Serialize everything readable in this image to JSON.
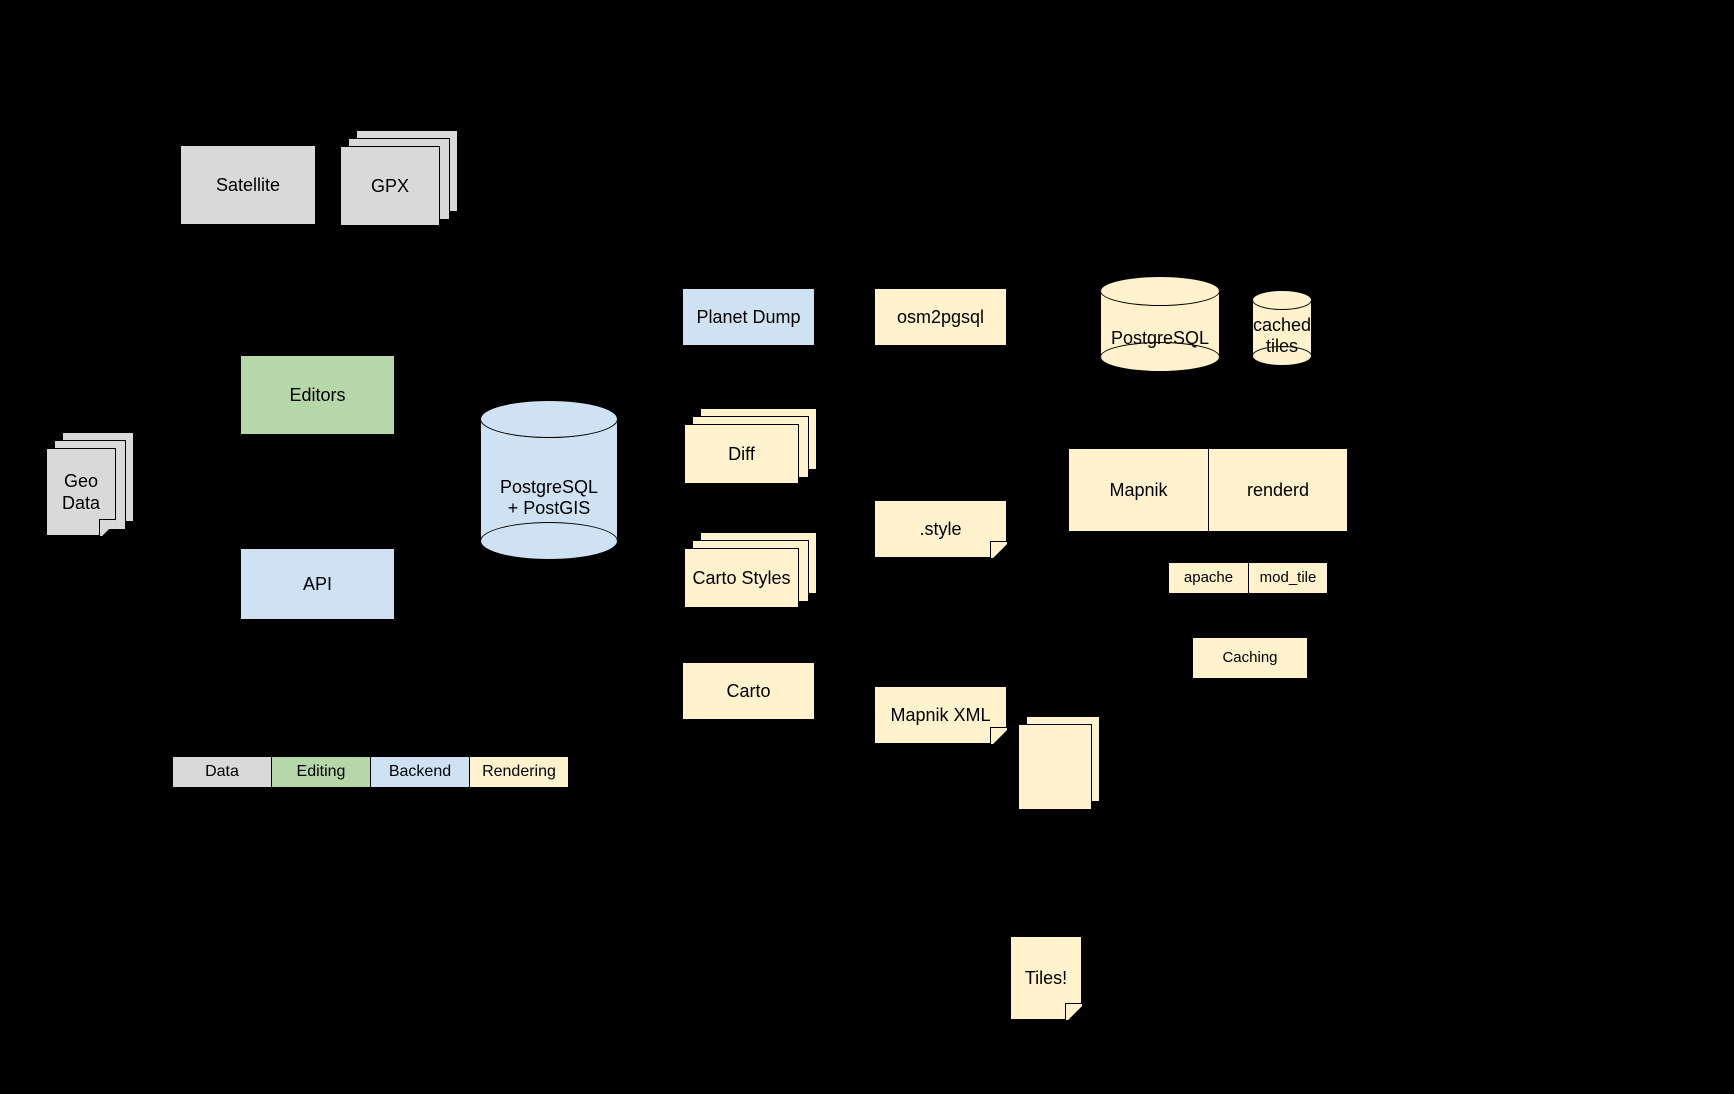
{
  "nodes": {
    "satellite": "Satellite",
    "gpx": "GPX",
    "geo_data_l1": "Geo",
    "geo_data_l2": "Data",
    "editors": "Editors",
    "api": "API",
    "db_pg_postgis_l1": "PostgreSQL",
    "db_pg_postgis_l2": "+ PostGIS",
    "planet_dump": "Planet Dump",
    "diff": "Diff",
    "carto_styles": "Carto Styles",
    "carto": "Carto",
    "osm2pgsql": "osm2pgsql",
    "style_file": ".style",
    "mapnik_xml": "Mapnik XML",
    "db_pg": "PostgreSQL",
    "cached_tiles_l1": "cached",
    "cached_tiles_l2": "tiles",
    "mapnik": "Mapnik",
    "renderd": "renderd",
    "apache": "apache",
    "mod_tile": "mod_tile",
    "caching": "Caching",
    "tiles": "Tiles!"
  },
  "legend": {
    "data": "Data",
    "editing": "Editing",
    "backend": "Backend",
    "rendering": "Rendering"
  },
  "colors": {
    "data": "#d9d9d9",
    "editing": "#b6d7a8",
    "backend": "#cfe2f3",
    "rendering": "#fff2cc",
    "bg": "#000000"
  },
  "arrows": [
    {
      "from": "satellite",
      "to": "editors"
    },
    {
      "from": "gpx",
      "to": "editors"
    },
    {
      "from": "geo_data",
      "to": "editors"
    },
    {
      "from": "geo_data",
      "to": "api"
    },
    {
      "from": "editors",
      "to": "api",
      "bidir": true
    },
    {
      "from": "api",
      "to": "postgresql_postgis",
      "bidir": true
    },
    {
      "from": "postgresql_postgis",
      "to": "planet_dump"
    },
    {
      "from": "postgresql_postgis",
      "to": "diff"
    },
    {
      "from": "planet_dump",
      "to": "osm2pgsql"
    },
    {
      "from": "diff",
      "to": "osm2pgsql"
    },
    {
      "from": "style_file",
      "to": "osm2pgsql"
    },
    {
      "from": "carto_styles",
      "to": "carto"
    },
    {
      "from": "carto",
      "to": "mapnik_xml"
    },
    {
      "from": "osm2pgsql",
      "to": "postgresql_render"
    },
    {
      "from": "postgresql_render",
      "to": "mapnik"
    },
    {
      "from": "mapnik_xml",
      "to": "mapnik"
    },
    {
      "from": "mapnik",
      "to": "renderd",
      "bidir": true
    },
    {
      "from": "renderd",
      "to": "cached_tiles",
      "bidir": true
    },
    {
      "from": "renderd",
      "to": "mod_tile",
      "bidir": true
    },
    {
      "from": "apache",
      "to": "mod_tile",
      "adjacent": true
    },
    {
      "from": "mod_tile",
      "to": "caching"
    },
    {
      "from": "caching",
      "to": "tiles"
    }
  ]
}
